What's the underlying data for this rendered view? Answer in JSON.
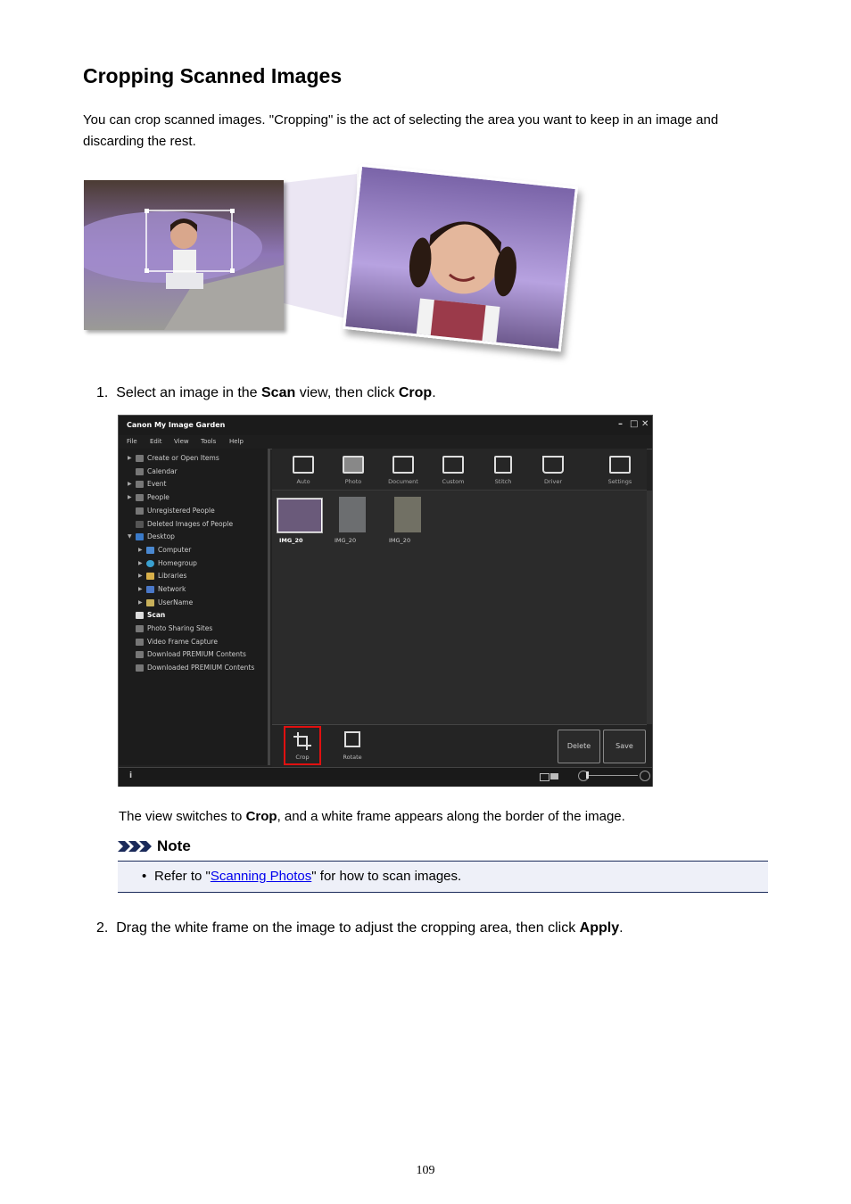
{
  "heading": "Cropping Scanned Images",
  "intro_line1": "You can crop scanned images. \"Cropping\" is the act of selecting the area you want to keep in an image and",
  "intro_line2": "discarding the rest.",
  "step1": {
    "num": "1.",
    "pre": "Select an image in the ",
    "b1": "Scan",
    "mid": " view, then click ",
    "b2": "Crop",
    "post": "."
  },
  "app": {
    "title": "Canon My Image Garden",
    "menu": [
      "File",
      "Edit",
      "View",
      "Tools",
      "Help"
    ],
    "nav": [
      "Create or Open Items",
      "Calendar",
      "Event",
      "People",
      "Unregistered People",
      "Deleted Images of People",
      "Desktop",
      "Computer",
      "Homegroup",
      "Libraries",
      "Network",
      "UserName",
      "Scan",
      "Photo Sharing Sites",
      "Video Frame Capture",
      "Download PREMIUM Contents",
      "Downloaded PREMIUM Contents"
    ],
    "toolbar": [
      "Auto",
      "Photo",
      "Document",
      "Custom",
      "Stitch",
      "Driver",
      "Settings"
    ],
    "thumbs": [
      "IMG_20",
      "IMG_20",
      "IMG_20"
    ],
    "crop_label": "Crop",
    "rotate_label": "Rotate",
    "delete_label": "Delete",
    "save_label": "Save",
    "info_glyph": "i",
    "accent_color": "#e01010"
  },
  "step1_result": {
    "pre": "The view switches to ",
    "b": "Crop",
    "post": ", and a white frame appears along the border of the image."
  },
  "note": {
    "title": "Note",
    "pre": "Refer to \"",
    "link": "Scanning Photos",
    "post": "\" for how to scan images."
  },
  "step2": {
    "num": "2.",
    "pre": "Drag the white frame on the image to adjust the cropping area, then click ",
    "b": "Apply",
    "post": "."
  },
  "page_number": "109"
}
